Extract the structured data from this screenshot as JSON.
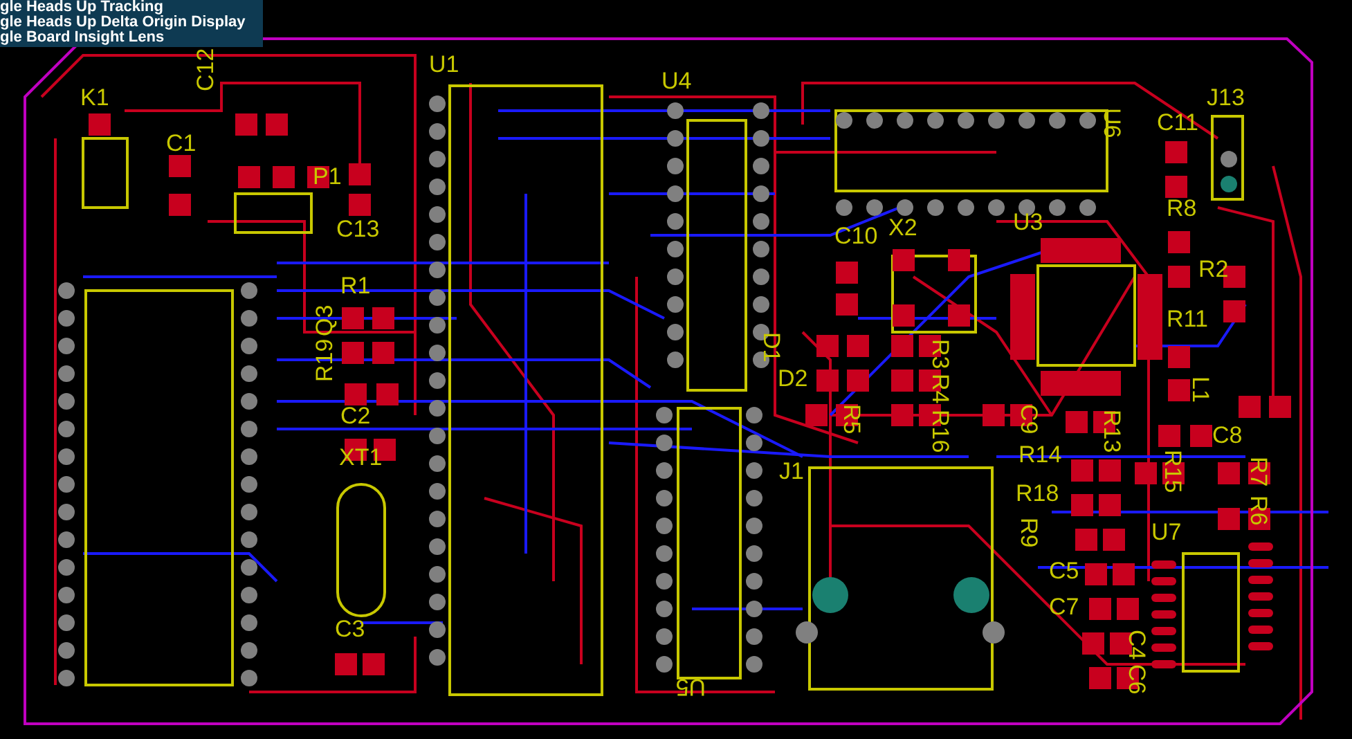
{
  "overlay": {
    "lines": [
      "gle Heads Up Tracking",
      "gle Heads Up Delta Origin Display",
      "gle Board Insight Lens"
    ]
  },
  "designators": [
    {
      "label": "K1"
    },
    {
      "label": "C12"
    },
    {
      "label": "C1"
    },
    {
      "label": "P1"
    },
    {
      "label": "C13"
    },
    {
      "label": "U1"
    },
    {
      "label": "U4"
    },
    {
      "label": "J13"
    },
    {
      "label": "C11"
    },
    {
      "label": "U6"
    },
    {
      "label": "R8"
    },
    {
      "label": "C10"
    },
    {
      "label": "X2"
    },
    {
      "label": "U3"
    },
    {
      "label": "R2"
    },
    {
      "label": "R1"
    },
    {
      "label": "R11"
    },
    {
      "label": "R19"
    },
    {
      "label": "Q3"
    },
    {
      "label": "D1"
    },
    {
      "label": "D2"
    },
    {
      "label": "R3"
    },
    {
      "label": "R4"
    },
    {
      "label": "R5"
    },
    {
      "label": "R16"
    },
    {
      "label": "C9"
    },
    {
      "label": "R13"
    },
    {
      "label": "L1"
    },
    {
      "label": "C2"
    },
    {
      "label": "XT1"
    },
    {
      "label": "R14"
    },
    {
      "label": "C8"
    },
    {
      "label": "R15"
    },
    {
      "label": "R7"
    },
    {
      "label": "R6"
    },
    {
      "label": "J1"
    },
    {
      "label": "R18"
    },
    {
      "label": "R9"
    },
    {
      "label": "U7"
    },
    {
      "label": "C5"
    },
    {
      "label": "C7"
    },
    {
      "label": "C4"
    },
    {
      "label": "C6"
    },
    {
      "label": "C3"
    },
    {
      "label": "U5"
    }
  ]
}
